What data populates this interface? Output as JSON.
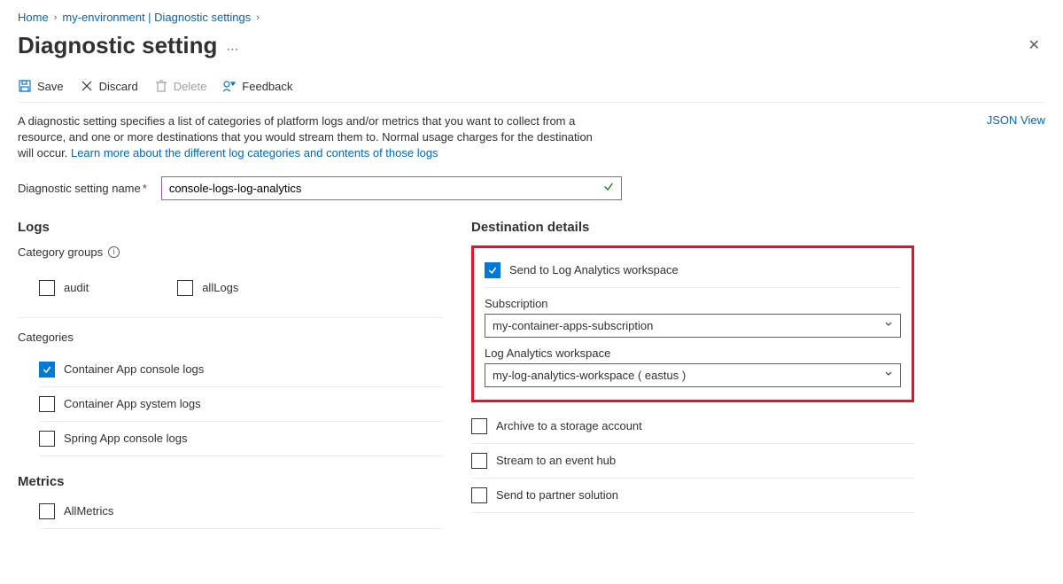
{
  "breadcrumb": {
    "home": "Home",
    "env": "my-environment | Diagnostic settings"
  },
  "page_title": "Diagnostic setting",
  "toolbar": {
    "save": "Save",
    "discard": "Discard",
    "delete": "Delete",
    "feedback": "Feedback"
  },
  "description": {
    "text": "A diagnostic setting specifies a list of categories of platform logs and/or metrics that you want to collect from a resource, and one or more destinations that you would stream them to. Normal usage charges for the destination will occur. ",
    "link": "Learn more about the different log categories and contents of those logs"
  },
  "json_view": "JSON View",
  "name_field": {
    "label": "Diagnostic setting name",
    "value": "console-logs-log-analytics"
  },
  "logs": {
    "title": "Logs",
    "category_groups_label": "Category groups",
    "groups": {
      "audit": {
        "label": "audit",
        "checked": false
      },
      "allLogs": {
        "label": "allLogs",
        "checked": false
      }
    },
    "categories_label": "Categories",
    "categories": [
      {
        "label": "Container App console logs",
        "checked": true
      },
      {
        "label": "Container App system logs",
        "checked": false
      },
      {
        "label": "Spring App console logs",
        "checked": false
      }
    ]
  },
  "metrics": {
    "title": "Metrics",
    "allmetrics": {
      "label": "AllMetrics",
      "checked": false
    }
  },
  "destinations": {
    "title": "Destination details",
    "log_analytics": {
      "label": "Send to Log Analytics workspace",
      "checked": true,
      "subscription_label": "Subscription",
      "subscription_value": "my-container-apps-subscription",
      "workspace_label": "Log Analytics workspace",
      "workspace_value": "my-log-analytics-workspace ( eastus )"
    },
    "storage": {
      "label": "Archive to a storage account",
      "checked": false
    },
    "eventhub": {
      "label": "Stream to an event hub",
      "checked": false
    },
    "partner": {
      "label": "Send to partner solution",
      "checked": false
    }
  }
}
